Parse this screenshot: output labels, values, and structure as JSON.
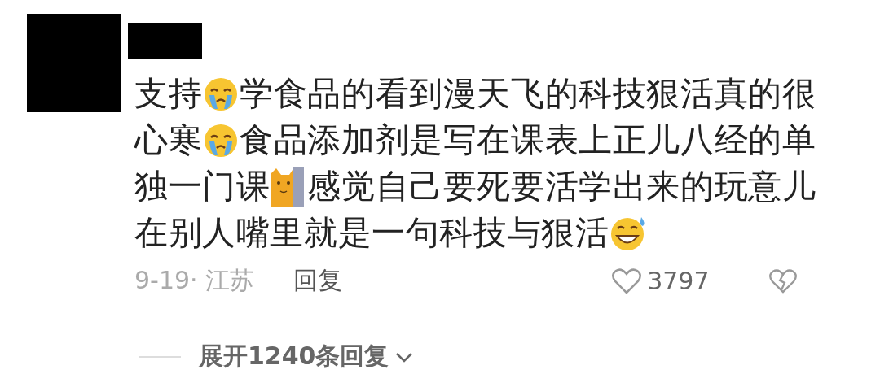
{
  "comment": {
    "lines": [
      [
        {
          "kind": "text",
          "text": "支持"
        },
        {
          "kind": "cry"
        },
        {
          "kind": "text",
          "text": "学食品的看到漫天飞的科技狠活真的很"
        }
      ],
      [
        {
          "kind": "text",
          "text": "心寒"
        },
        {
          "kind": "cry"
        },
        {
          "kind": "text",
          "text": "食品添加剂是写在课表上正儿八经的单"
        }
      ],
      [
        {
          "kind": "text",
          "text": "独一门课"
        },
        {
          "kind": "cat"
        },
        {
          "kind": "text",
          "text": "感觉自己要死要活学出来的玩意儿"
        }
      ],
      [
        {
          "kind": "text",
          "text": "在别人嘴里就是一句科技与狠活"
        },
        {
          "kind": "grin"
        }
      ]
    ],
    "meta": "9-19· 江苏",
    "reply": "回复",
    "likes": "3797",
    "expand": "展开1240条回复"
  }
}
